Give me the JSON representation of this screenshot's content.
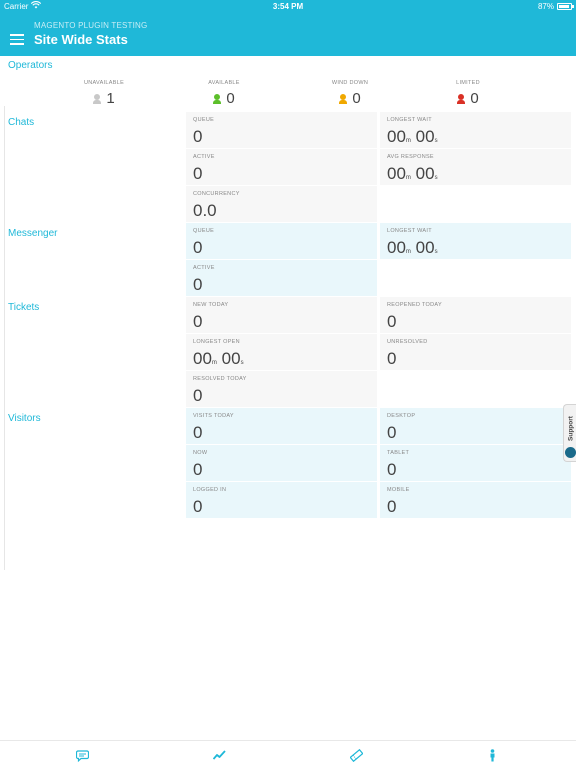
{
  "status_bar": {
    "carrier": "Carrier",
    "time": "3:54 PM",
    "battery": "87%"
  },
  "header": {
    "subtitle": "MAGENTO PLUGIN TESTING",
    "title": "Site Wide Stats"
  },
  "sections": {
    "operators": "Operators",
    "chats": "Chats",
    "messenger": "Messenger",
    "tickets": "Tickets",
    "visitors": "Visitors"
  },
  "operators": [
    {
      "label": "UNAVAILABLE",
      "value": "1",
      "color": "#c8c8c8"
    },
    {
      "label": "AVAILABLE",
      "value": "0",
      "color": "#5cbf2a"
    },
    {
      "label": "WIND DOWN",
      "value": "0",
      "color": "#f0a800"
    },
    {
      "label": "LIMITED",
      "value": "0",
      "color": "#d93025"
    }
  ],
  "chats": {
    "queue": {
      "label": "QUEUE",
      "value": "0"
    },
    "longest_wait": {
      "label": "LONGEST WAIT",
      "minutes": "00",
      "m_unit": "m",
      "seconds": "00",
      "s_unit": "s"
    },
    "active": {
      "label": "ACTIVE",
      "value": "0"
    },
    "avg_response": {
      "label": "AVG RESPONSE",
      "minutes": "00",
      "m_unit": "m",
      "seconds": "00",
      "s_unit": "s"
    },
    "concurrency": {
      "label": "CONCURRENCY",
      "value": "0.0"
    }
  },
  "messenger": {
    "queue": {
      "label": "QUEUE",
      "value": "0"
    },
    "longest_wait": {
      "label": "LONGEST WAIT",
      "minutes": "00",
      "m_unit": "m",
      "seconds": "00",
      "s_unit": "s"
    },
    "active": {
      "label": "ACTIVE",
      "value": "0"
    }
  },
  "tickets": {
    "new_today": {
      "label": "NEW TODAY",
      "value": "0"
    },
    "reopened_today": {
      "label": "REOPENED TODAY",
      "value": "0"
    },
    "longest_open": {
      "label": "LONGEST OPEN",
      "minutes": "00",
      "m_unit": "m",
      "seconds": "00",
      "s_unit": "s"
    },
    "unresolved": {
      "label": "UNRESOLVED",
      "value": "0"
    },
    "resolved_today": {
      "label": "RESOLVED TODAY",
      "value": "0"
    }
  },
  "visitors": {
    "visits_today": {
      "label": "VISITS TODAY",
      "value": "0"
    },
    "desktop": {
      "label": "DESKTOP",
      "value": "0"
    },
    "now": {
      "label": "NOW",
      "value": "0"
    },
    "tablet": {
      "label": "TABLET",
      "value": "0"
    },
    "logged_in": {
      "label": "LOGGED IN",
      "value": "0"
    },
    "mobile": {
      "label": "MOBILE",
      "value": "0"
    }
  },
  "support_tab": {
    "label": "Support"
  },
  "colors": {
    "accent": "#1fb8d8"
  },
  "tabbar_icons": [
    "chat-bubble-icon",
    "activity-icon",
    "ticket-icon",
    "visitor-icon"
  ]
}
